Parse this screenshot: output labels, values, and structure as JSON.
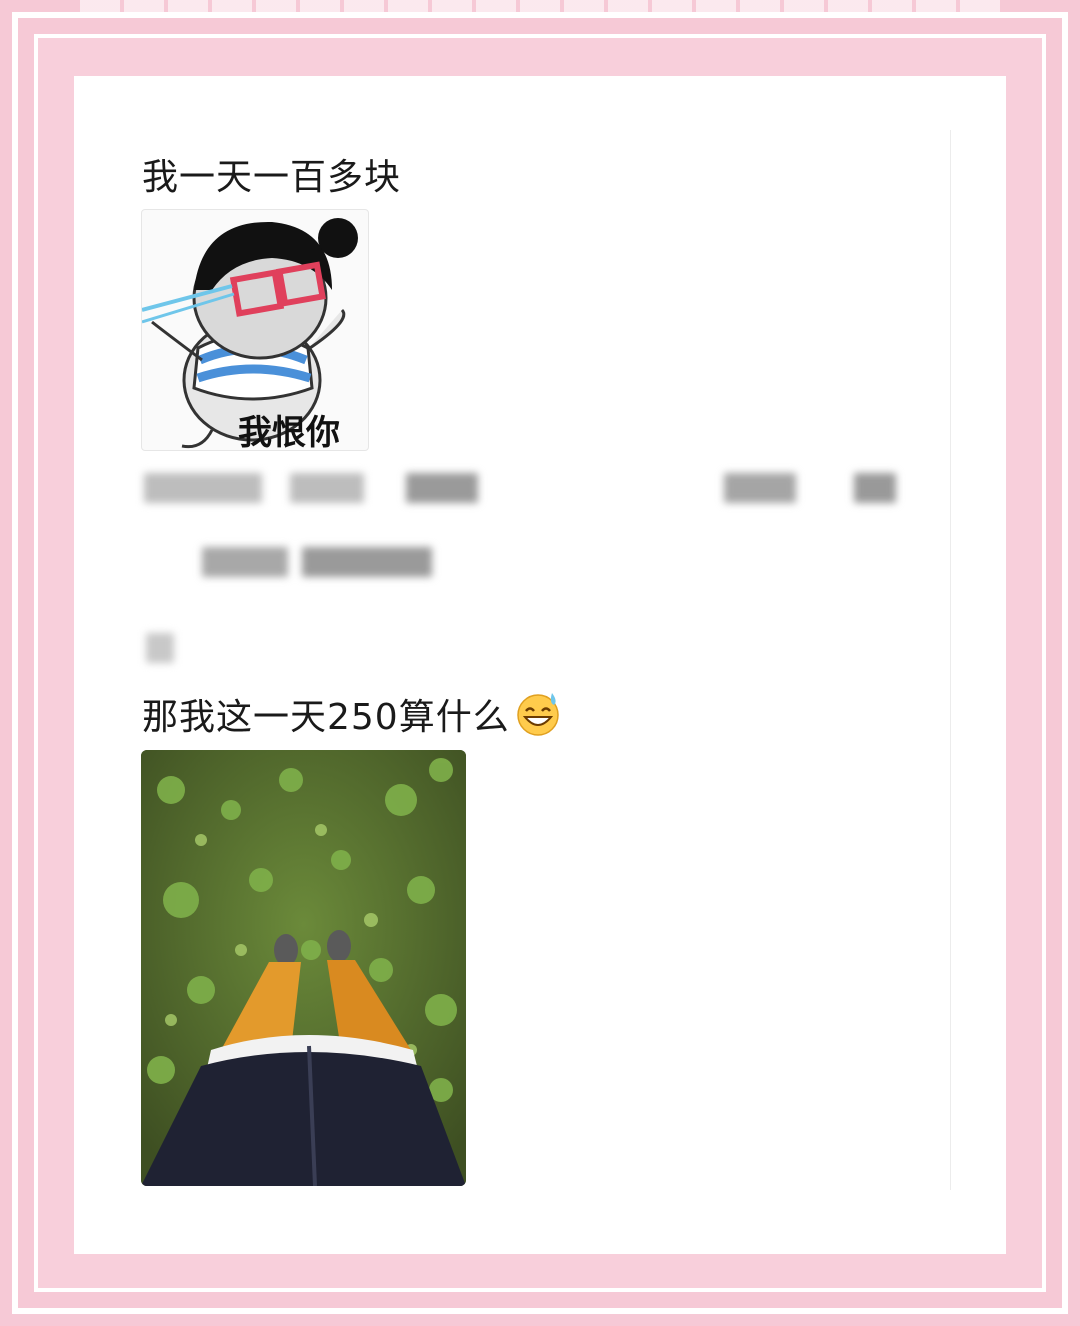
{
  "post": {
    "line1": "我一天一百多块",
    "sticker_caption": "我恨你",
    "line2": "那我这一天250算什么",
    "emoji": "grinning-sweat-emoji"
  },
  "colors": {
    "background_pink": "#f6c9d6",
    "page": "#ffffff",
    "text": "#1a1a1a"
  }
}
